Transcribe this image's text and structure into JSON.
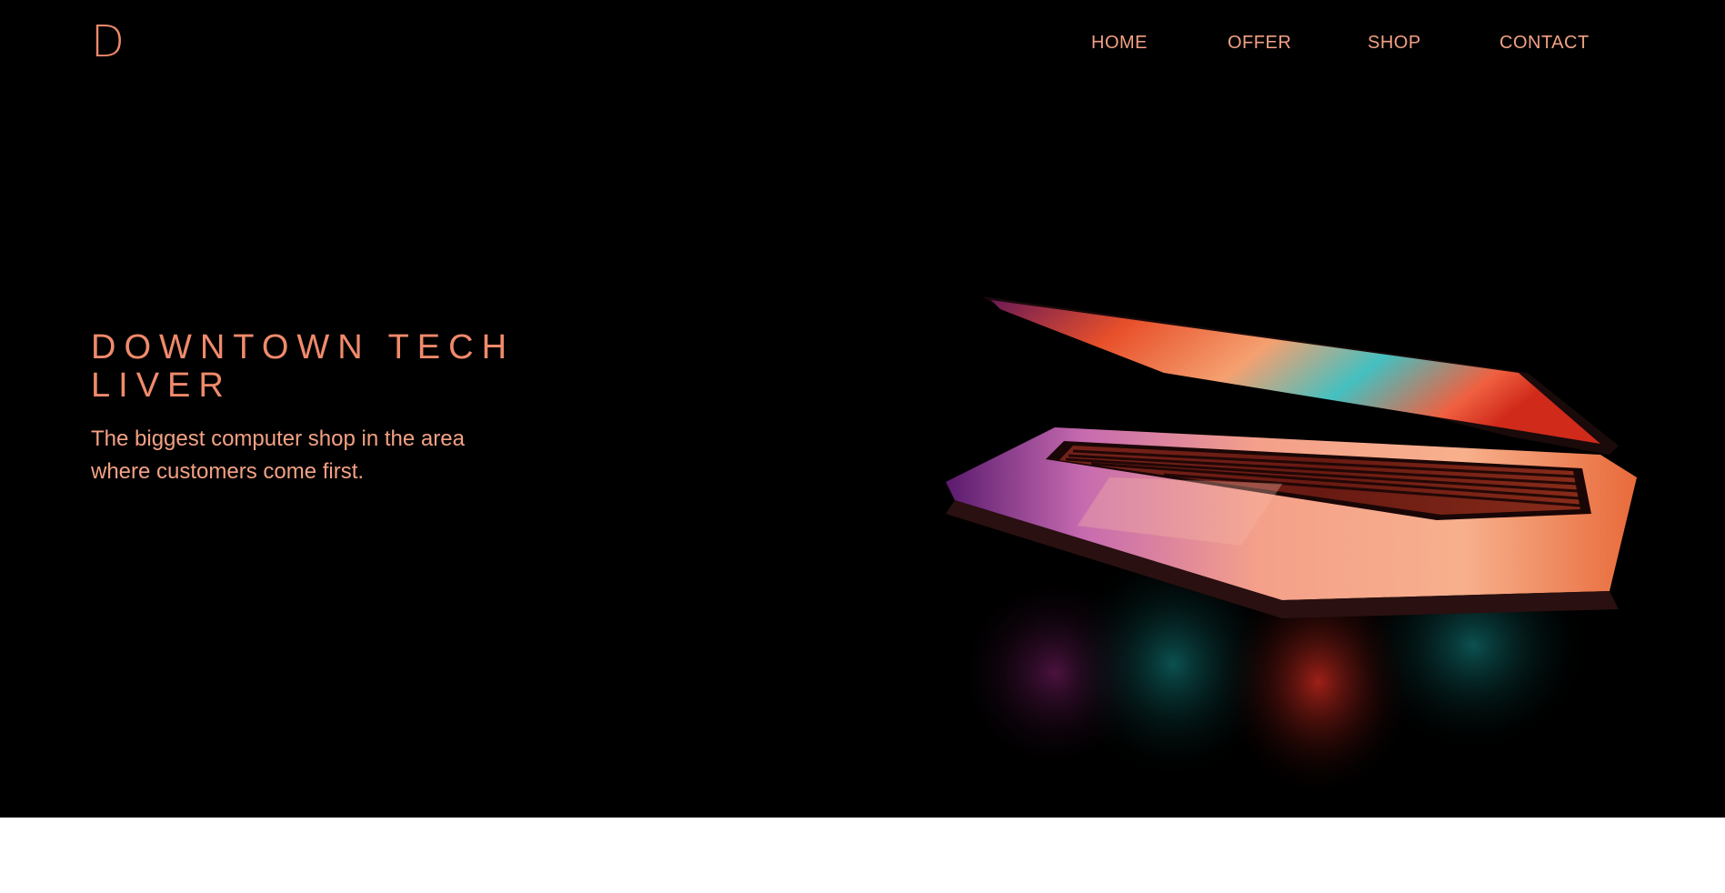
{
  "logo": {
    "text": "D"
  },
  "nav": {
    "items": [
      {
        "label": "HOME"
      },
      {
        "label": "OFFER"
      },
      {
        "label": "SHOP"
      },
      {
        "label": "CONTACT"
      }
    ]
  },
  "hero": {
    "title": "DOWNTOWN TECH LIVER",
    "tagline": "The biggest computer shop in the area where customers come first.",
    "image": {
      "subject": "laptop-photo"
    }
  },
  "colors": {
    "background": "#000000",
    "accent": "#f08a6c",
    "nav_text": "#f2a184",
    "below_fold": "#ffffff"
  }
}
